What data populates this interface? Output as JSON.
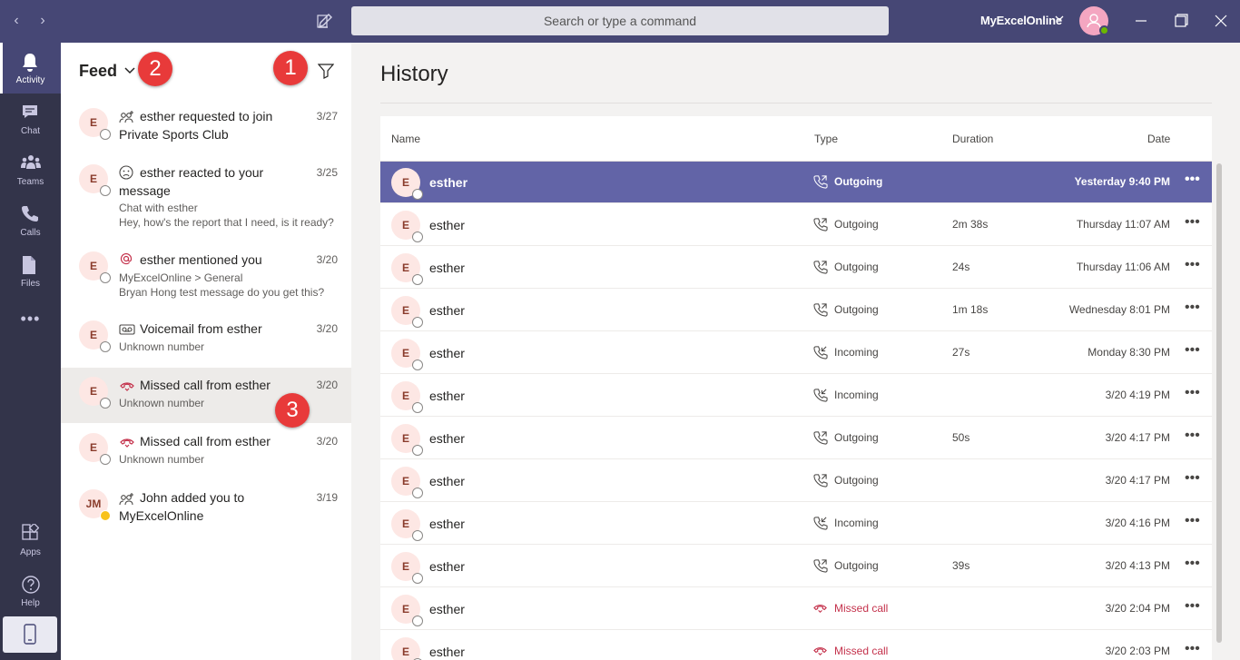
{
  "titlebar": {
    "back_label": "‹",
    "forward_label": "›",
    "search_placeholder": "Search or type a command",
    "org_name": "MyExcelOnline"
  },
  "rail": {
    "items": [
      {
        "label": "Activity",
        "icon": "bell-icon"
      },
      {
        "label": "Chat",
        "icon": "chat-icon"
      },
      {
        "label": "Teams",
        "icon": "teams-icon"
      },
      {
        "label": "Calls",
        "icon": "phone-icon"
      },
      {
        "label": "Files",
        "icon": "file-icon"
      },
      {
        "label": "Apps",
        "icon": "apps-icon"
      },
      {
        "label": "Help",
        "icon": "help-icon"
      }
    ],
    "more_label": "•••"
  },
  "feed": {
    "title": "Feed",
    "badges": [
      "1",
      "2",
      "3"
    ],
    "items": [
      {
        "initials": "E",
        "line1": "esther requested to join",
        "line2": "Private Sports Club",
        "date": "3/27",
        "icon": "add-member-icon"
      },
      {
        "initials": "E",
        "line1": "esther reacted to your",
        "line2": "message",
        "sub1": "Chat with esther",
        "sub2": "Hey, how's the report that I need, is it ready?",
        "date": "3/25",
        "icon": "reaction-icon"
      },
      {
        "initials": "E",
        "line1": "esther mentioned you",
        "sub1": "MyExcelOnline > General",
        "sub2": "Bryan Hong test message do you get this?",
        "date": "3/20",
        "icon": "mention-icon"
      },
      {
        "initials": "E",
        "line1": "Voicemail from esther",
        "sub1": "Unknown number",
        "date": "3/20",
        "icon": "voicemail-icon"
      },
      {
        "initials": "E",
        "line1": "Missed call from esther",
        "sub1": "Unknown number",
        "date": "3/20",
        "icon": "missed-call-icon"
      },
      {
        "initials": "E",
        "line1": "Missed call from esther",
        "sub1": "Unknown number",
        "date": "3/20",
        "icon": "missed-call-icon"
      },
      {
        "initials": "JM",
        "line1": "John added you to",
        "line2": "MyExcelOnline",
        "date": "3/19",
        "icon": "add-member-icon"
      }
    ]
  },
  "history": {
    "title": "History",
    "columns": {
      "name": "Name",
      "type": "Type",
      "duration": "Duration",
      "date": "Date"
    },
    "more_label": "•••",
    "rows": [
      {
        "initials": "E",
        "name": "esther",
        "type": "Outgoing",
        "duration": "",
        "date": "Yesterday 9:40 PM"
      },
      {
        "initials": "E",
        "name": "esther",
        "type": "Outgoing",
        "duration": "2m 38s",
        "date": "Thursday 11:07 AM"
      },
      {
        "initials": "E",
        "name": "esther",
        "type": "Outgoing",
        "duration": "24s",
        "date": "Thursday 11:06 AM"
      },
      {
        "initials": "E",
        "name": "esther",
        "type": "Outgoing",
        "duration": "1m 18s",
        "date": "Wednesday 8:01 PM"
      },
      {
        "initials": "E",
        "name": "esther",
        "type": "Incoming",
        "duration": "27s",
        "date": "Monday 8:30 PM"
      },
      {
        "initials": "E",
        "name": "esther",
        "type": "Incoming",
        "duration": "",
        "date": "3/20 4:19 PM"
      },
      {
        "initials": "E",
        "name": "esther",
        "type": "Outgoing",
        "duration": "50s",
        "date": "3/20 4:17 PM"
      },
      {
        "initials": "E",
        "name": "esther",
        "type": "Outgoing",
        "duration": "",
        "date": "3/20 4:17 PM"
      },
      {
        "initials": "E",
        "name": "esther",
        "type": "Incoming",
        "duration": "",
        "date": "3/20 4:16 PM"
      },
      {
        "initials": "E",
        "name": "esther",
        "type": "Outgoing",
        "duration": "39s",
        "date": "3/20 4:13 PM"
      },
      {
        "initials": "E",
        "name": "esther",
        "type": "Missed call",
        "duration": "",
        "date": "3/20 2:04 PM"
      },
      {
        "initials": "E",
        "name": "esther",
        "type": "Missed call",
        "duration": "",
        "date": "3/20 2:03 PM"
      }
    ]
  },
  "colors": {
    "titlebar": "#464775",
    "rail": "#33344a",
    "selected_row": "#6264a7",
    "missed": "#c4314b",
    "badge": "#e83a3a"
  }
}
